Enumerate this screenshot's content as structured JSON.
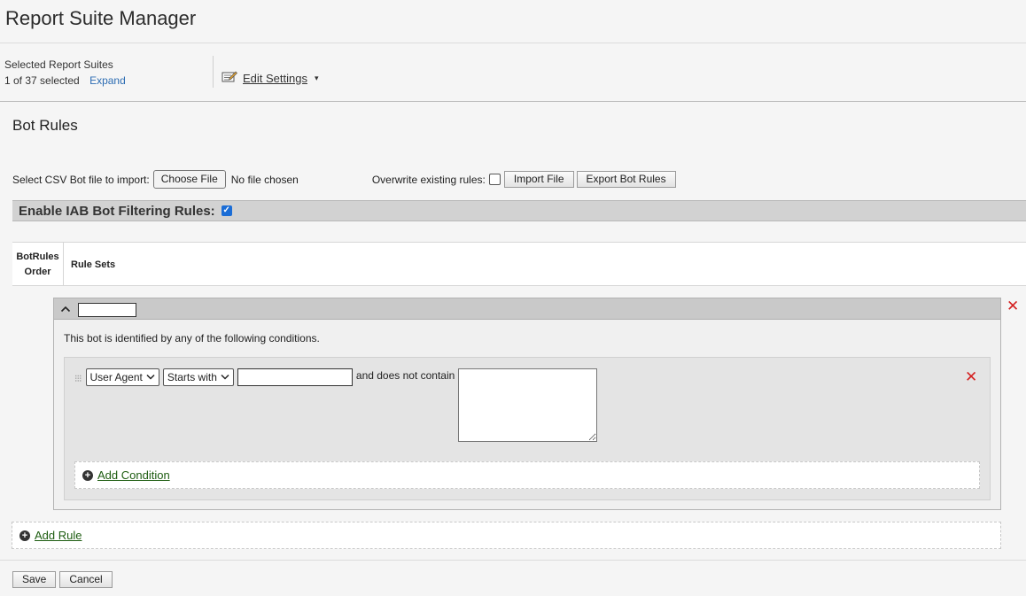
{
  "app": {
    "title": "Report Suite Manager"
  },
  "selection": {
    "label": "Selected Report Suites",
    "count": "1 of 37 selected",
    "expand_label": "Expand"
  },
  "toolbar": {
    "edit_settings_label": "Edit Settings",
    "edit_icon": "edit-settings-icon",
    "caret": "▾"
  },
  "section": {
    "title": "Bot Rules"
  },
  "import": {
    "label": "Select CSV Bot file to import:",
    "choose_file_label": "Choose File",
    "no_file_text": "No file chosen",
    "overwrite_label": "Overwrite existing rules:",
    "overwrite_checked": false,
    "import_button_label": "Import File",
    "export_button_label": "Export Bot Rules"
  },
  "iab": {
    "label": "Enable IAB Bot Filtering Rules:",
    "checked": true
  },
  "table": {
    "col_order_line1": "BotRules",
    "col_order_line2": "Order",
    "col_rules": "Rule Sets"
  },
  "rule": {
    "collapse_icon": "chevron-up-icon",
    "name_value": "",
    "description": "This bot is identified by any of the following conditions.",
    "condition": {
      "field_select": "User Agent",
      "operator_select": "Starts with",
      "value": "",
      "and_not_label": "and does not contain",
      "exclude_value": ""
    },
    "add_condition_label": "Add Condition"
  },
  "add_rule_label": "Add Rule",
  "footer": {
    "save_label": "Save",
    "cancel_label": "Cancel"
  },
  "colors": {
    "delete": "#d42020",
    "link_green": "#1d5c10",
    "link_blue": "#2d6db3",
    "checkbox": "#1b6dd6"
  }
}
